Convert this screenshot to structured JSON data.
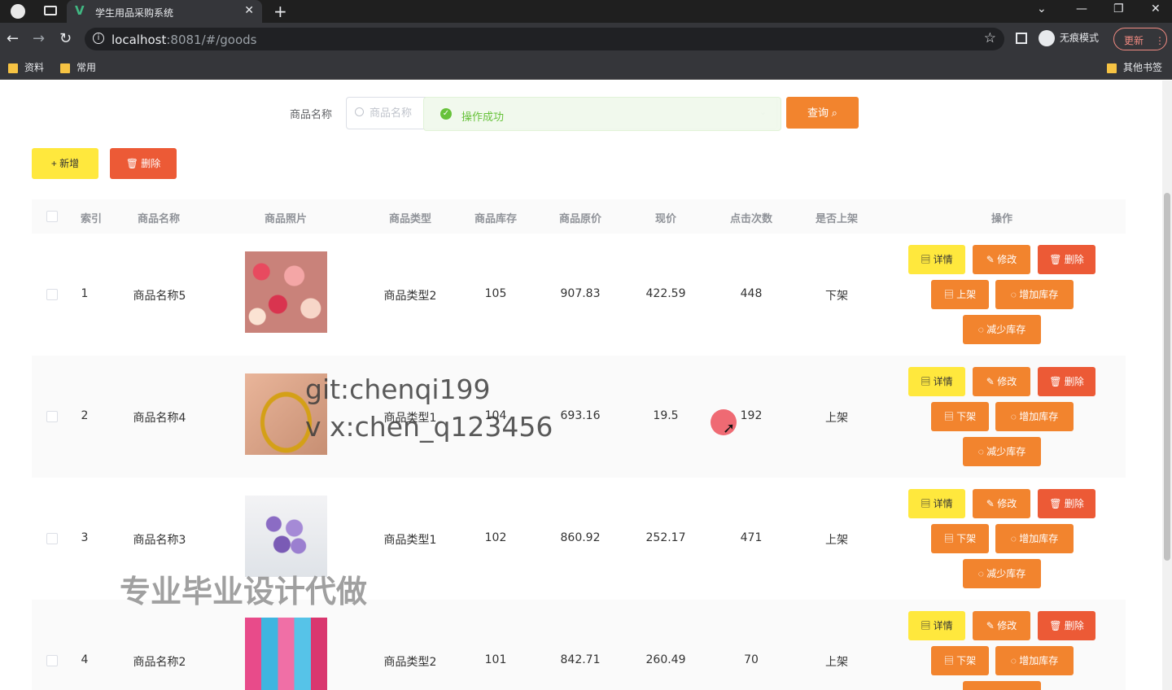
{
  "browser": {
    "tab_title": "学生用品采购系统",
    "url_host": "localhost",
    "url_rest": ":8081/#/goods",
    "incognito_label": "无痕模式",
    "update_label": "更新",
    "bookmarks": [
      "资料",
      "常用"
    ],
    "other_bookmarks": "其他书签"
  },
  "search": {
    "label": "商品名称",
    "placeholder": "商品名称",
    "query_label": "查询"
  },
  "toast": {
    "message": "操作成功"
  },
  "toolbar": {
    "add_label": "+ 新增",
    "delete_label": "删除"
  },
  "table": {
    "headers": [
      "索引",
      "商品名称",
      "商品照片",
      "商品类型",
      "商品库存",
      "商品原价",
      "现价",
      "点击次数",
      "是否上架",
      "操作"
    ],
    "rows": [
      {
        "index": "1",
        "name": "商品名称5",
        "type": "商品类型2",
        "stock": "105",
        "orig_price": "907.83",
        "price": "422.59",
        "clicks": "448",
        "listed": "下架",
        "toggle_label": "上架"
      },
      {
        "index": "2",
        "name": "商品名称4",
        "type": "商品类型1",
        "stock": "104",
        "orig_price": "693.16",
        "price": "19.5",
        "clicks": "192",
        "listed": "上架",
        "toggle_label": "下架"
      },
      {
        "index": "3",
        "name": "商品名称3",
        "type": "商品类型1",
        "stock": "102",
        "orig_price": "860.92",
        "price": "252.17",
        "clicks": "471",
        "listed": "上架",
        "toggle_label": "下架"
      },
      {
        "index": "4",
        "name": "商品名称2",
        "type": "商品类型2",
        "stock": "101",
        "orig_price": "842.71",
        "price": "260.49",
        "clicks": "70",
        "listed": "上架",
        "toggle_label": "下架"
      }
    ],
    "op_labels": {
      "detail": "详情",
      "edit": "修改",
      "delete": "删除",
      "add_stock": "增加库存",
      "reduce_stock": "减少库存"
    }
  },
  "watermarks": {
    "line1": "git:chenqi199",
    "line2": "v x:chen_q123456",
    "line3": "专业毕业设计代做"
  },
  "colors": {
    "yellow_button": "#ffe83d",
    "orange_button": "#f2842e",
    "red_button": "#ec5a36",
    "success": "#67c23a"
  }
}
